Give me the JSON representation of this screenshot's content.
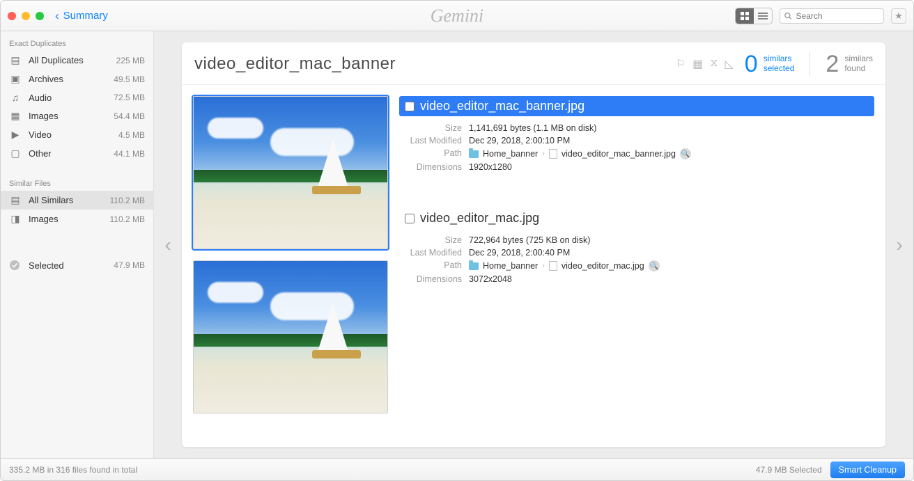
{
  "app_name": "Gemini",
  "titlebar": {
    "back_label": "Summary",
    "search_placeholder": "Search"
  },
  "sidebar": {
    "section_exact": "Exact Duplicates",
    "section_similar": "Similar Files",
    "exact": [
      {
        "icon": "stack",
        "label": "All Duplicates",
        "size": "225 MB"
      },
      {
        "icon": "archive",
        "label": "Archives",
        "size": "49.5 MB"
      },
      {
        "icon": "audio",
        "label": "Audio",
        "size": "72.5 MB"
      },
      {
        "icon": "image",
        "label": "Images",
        "size": "54.4 MB"
      },
      {
        "icon": "video",
        "label": "Video",
        "size": "4.5 MB"
      },
      {
        "icon": "doc",
        "label": "Other",
        "size": "44.1 MB"
      }
    ],
    "similar": [
      {
        "icon": "stack",
        "label": "All Similars",
        "size": "110.2 MB",
        "active": true
      },
      {
        "icon": "image",
        "label": "Images",
        "size": "110.2 MB"
      }
    ],
    "selected": {
      "label": "Selected",
      "size": "47.9 MB"
    }
  },
  "panel": {
    "title": "video_editor_mac_banner",
    "stats": {
      "selected_count": "0",
      "selected_l1": "similars",
      "selected_l2": "selected",
      "found_count": "2",
      "found_l1": "similars",
      "found_l2": "found"
    },
    "files": [
      {
        "selected": true,
        "checked": false,
        "name": "video_editor_mac_banner.jpg",
        "size": "1,141,691 bytes (1.1 MB on disk)",
        "modified": "Dec 29, 2018, 2:00:10 PM",
        "path_folder": "Home_banner",
        "path_file": "video_editor_mac_banner.jpg",
        "dimensions": "1920x1280"
      },
      {
        "selected": false,
        "checked": false,
        "name": "video_editor_mac.jpg",
        "size": "722,964 bytes (725 KB on disk)",
        "modified": "Dec 29, 2018, 2:00:40 PM",
        "path_folder": "Home_banner",
        "path_file": "video_editor_mac.jpg",
        "dimensions": "3072x2048"
      }
    ],
    "labels": {
      "size": "Size",
      "modified": "Last Modified",
      "path": "Path",
      "dimensions": "Dimensions"
    }
  },
  "footer": {
    "summary": "335.2 MB in 316 files found in total",
    "selected": "47.9 MB Selected",
    "cleanup": "Smart Cleanup"
  }
}
